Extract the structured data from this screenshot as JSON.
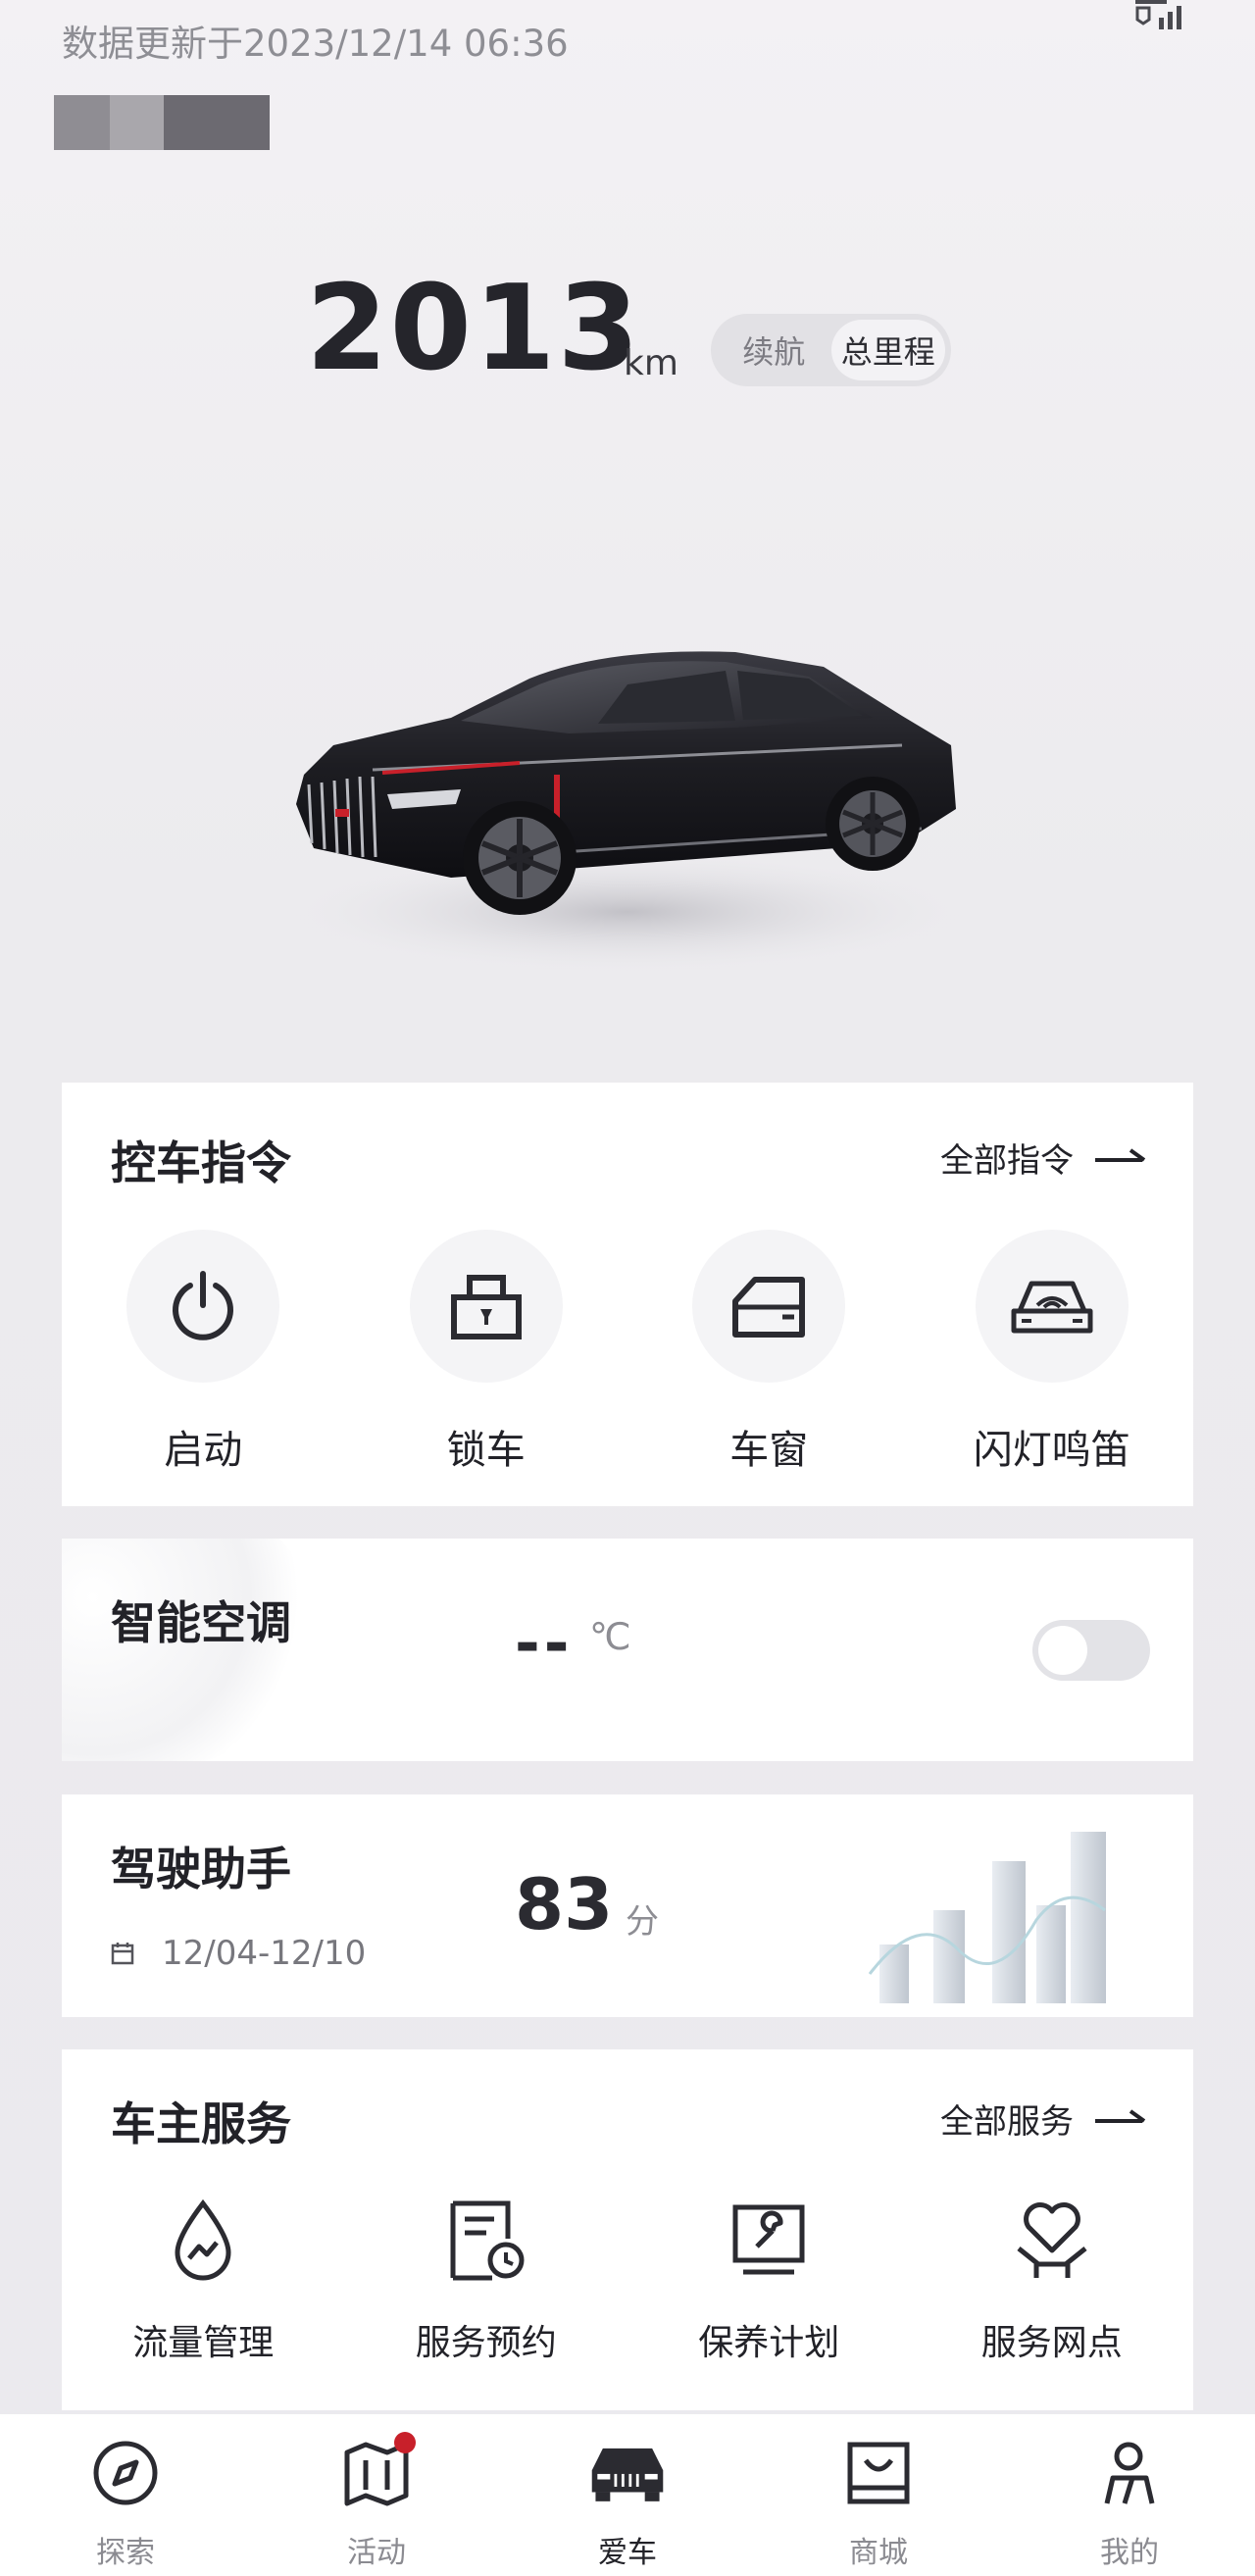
{
  "header": {
    "update_time": "数据更新于2023/12/14 06:36"
  },
  "mileage": {
    "value": "2013",
    "unit": "km",
    "modes": [
      "续航",
      "总里程"
    ],
    "active_mode": "总里程"
  },
  "control": {
    "title": "控车指令",
    "all_link": "全部指令",
    "items": [
      {
        "label": "启动",
        "icon": "power-icon"
      },
      {
        "label": "锁车",
        "icon": "lock-icon"
      },
      {
        "label": "车窗",
        "icon": "window-icon"
      },
      {
        "label": "闪灯鸣笛",
        "icon": "horn-light-icon"
      }
    ]
  },
  "ac": {
    "title": "智能空调",
    "temp": "--",
    "unit": "℃",
    "enabled": false
  },
  "drive": {
    "title": "驾驶助手",
    "date_range": "12/04-12/10",
    "score": "83",
    "score_unit": "分"
  },
  "services": {
    "title": "车主服务",
    "all_link": "全部服务",
    "items": [
      {
        "label": "流量管理",
        "icon": "data-drop-icon"
      },
      {
        "label": "服务预约",
        "icon": "booking-icon"
      },
      {
        "label": "保养计划",
        "icon": "maintenance-icon"
      },
      {
        "label": "服务网点",
        "icon": "service-point-icon"
      }
    ]
  },
  "tabbar": {
    "items": [
      {
        "label": "探索",
        "icon": "compass-icon"
      },
      {
        "label": "活动",
        "icon": "map-icon",
        "badge": true
      },
      {
        "label": "爱车",
        "icon": "car-icon",
        "active": true
      },
      {
        "label": "商城",
        "icon": "bag-icon"
      },
      {
        "label": "我的",
        "icon": "person-icon"
      }
    ]
  },
  "colors": {
    "accent_red": "#c8202a",
    "text_dark": "#222228",
    "text_muted": "#8b8b91",
    "card_bg": "#ffffff"
  }
}
